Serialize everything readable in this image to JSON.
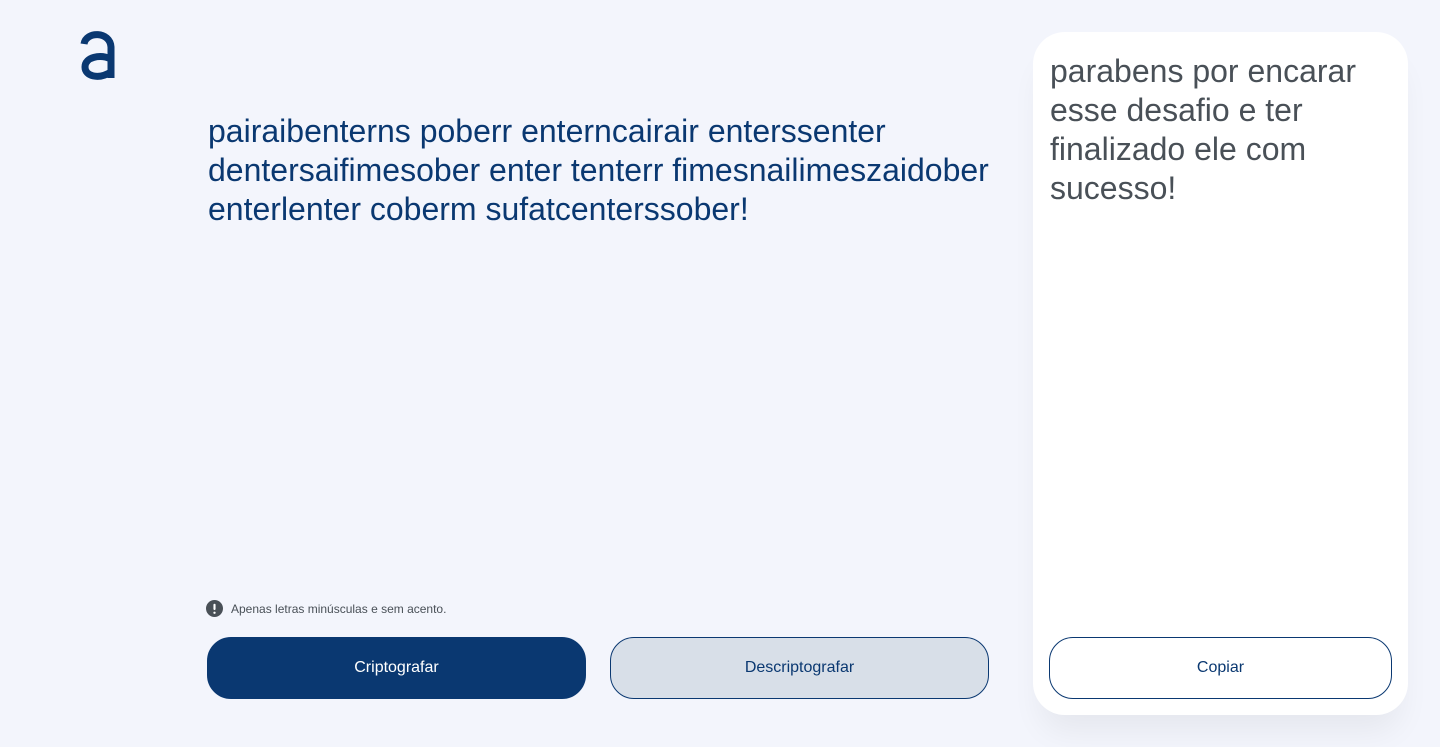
{
  "brand": {
    "logo_icon": "alura-a-logo-icon",
    "color": "#0a3871"
  },
  "input": {
    "value": "pairaibenterns poberr enterncairair enterssenter dentersaifimesober enter tenterr fimesnailimeszaidober enterlenter coberm sufatcenterssober!"
  },
  "hint": {
    "icon": "exclamation-circle-icon",
    "text": "Apenas letras minúsculas e sem acento."
  },
  "actions": {
    "encrypt_label": "Criptografar",
    "decrypt_label": "Descriptografar"
  },
  "output": {
    "text": "parabens por encarar esse desafio e ter finalizado ele com sucesso!",
    "copy_label": "Copiar"
  },
  "colors": {
    "background": "#f3f5fc",
    "primary": "#0a3871",
    "secondary_button": "#d8dfe8",
    "output_text": "#495057"
  }
}
